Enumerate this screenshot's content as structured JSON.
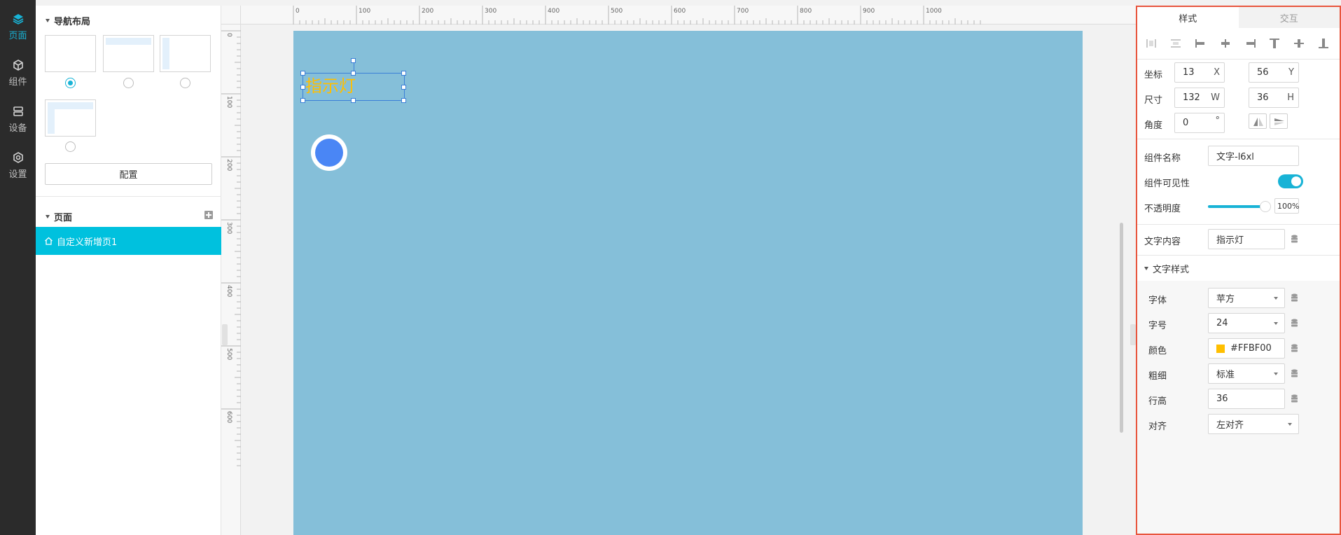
{
  "rail": {
    "items": [
      {
        "label": "页面",
        "icon": "layers-icon",
        "active": true
      },
      {
        "label": "组件",
        "icon": "cube-icon",
        "active": false
      },
      {
        "label": "设备",
        "icon": "server-icon",
        "active": false
      },
      {
        "label": "设置",
        "icon": "gear-icon",
        "active": false
      }
    ]
  },
  "layout_panel": {
    "title": "导航布局",
    "selected_index": 0,
    "config_button": "配置"
  },
  "pages_panel": {
    "title": "页面",
    "pages": [
      {
        "label": "自定义新增页1",
        "active": true
      }
    ]
  },
  "ruler": {
    "top_labels": [
      "0",
      "100",
      "200",
      "300",
      "400",
      "500",
      "600",
      "700",
      "800",
      "900",
      "1000"
    ],
    "left_labels": [
      "0",
      "100",
      "200",
      "300",
      "400",
      "500",
      "600"
    ]
  },
  "canvas": {
    "background": "#85bfd9",
    "text_component": {
      "text": "指示灯",
      "color": "#FFBF00"
    },
    "lamp_color": "#4a86f5"
  },
  "props": {
    "tabs": [
      {
        "label": "样式",
        "active": true
      },
      {
        "label": "交互",
        "active": false
      }
    ],
    "coord_label": "坐标",
    "x": "13",
    "x_unit": "X",
    "y": "56",
    "y_unit": "Y",
    "size_label": "尺寸",
    "w": "132",
    "w_unit": "W",
    "h": "36",
    "h_unit": "H",
    "angle_label": "角度",
    "angle": "0",
    "angle_unit": "°",
    "name_label": "组件名称",
    "name": "文字-l6xl",
    "visible_label": "组件可见性",
    "visible": true,
    "opacity_label": "不透明度",
    "opacity": "100%",
    "content_label": "文字内容",
    "content": "指示灯",
    "text_style_title": "文字样式",
    "font_label": "字体",
    "font": "苹方",
    "size2_label": "字号",
    "font_size": "24",
    "color_label": "颜色",
    "color": "#FFBF00",
    "weight_label": "粗细",
    "weight": "标准",
    "line_height_label": "行高",
    "line_height": "36",
    "align_label": "对齐",
    "align": "左对齐",
    "accent": "#18b3d6",
    "highlight_border": "#e8553d"
  }
}
